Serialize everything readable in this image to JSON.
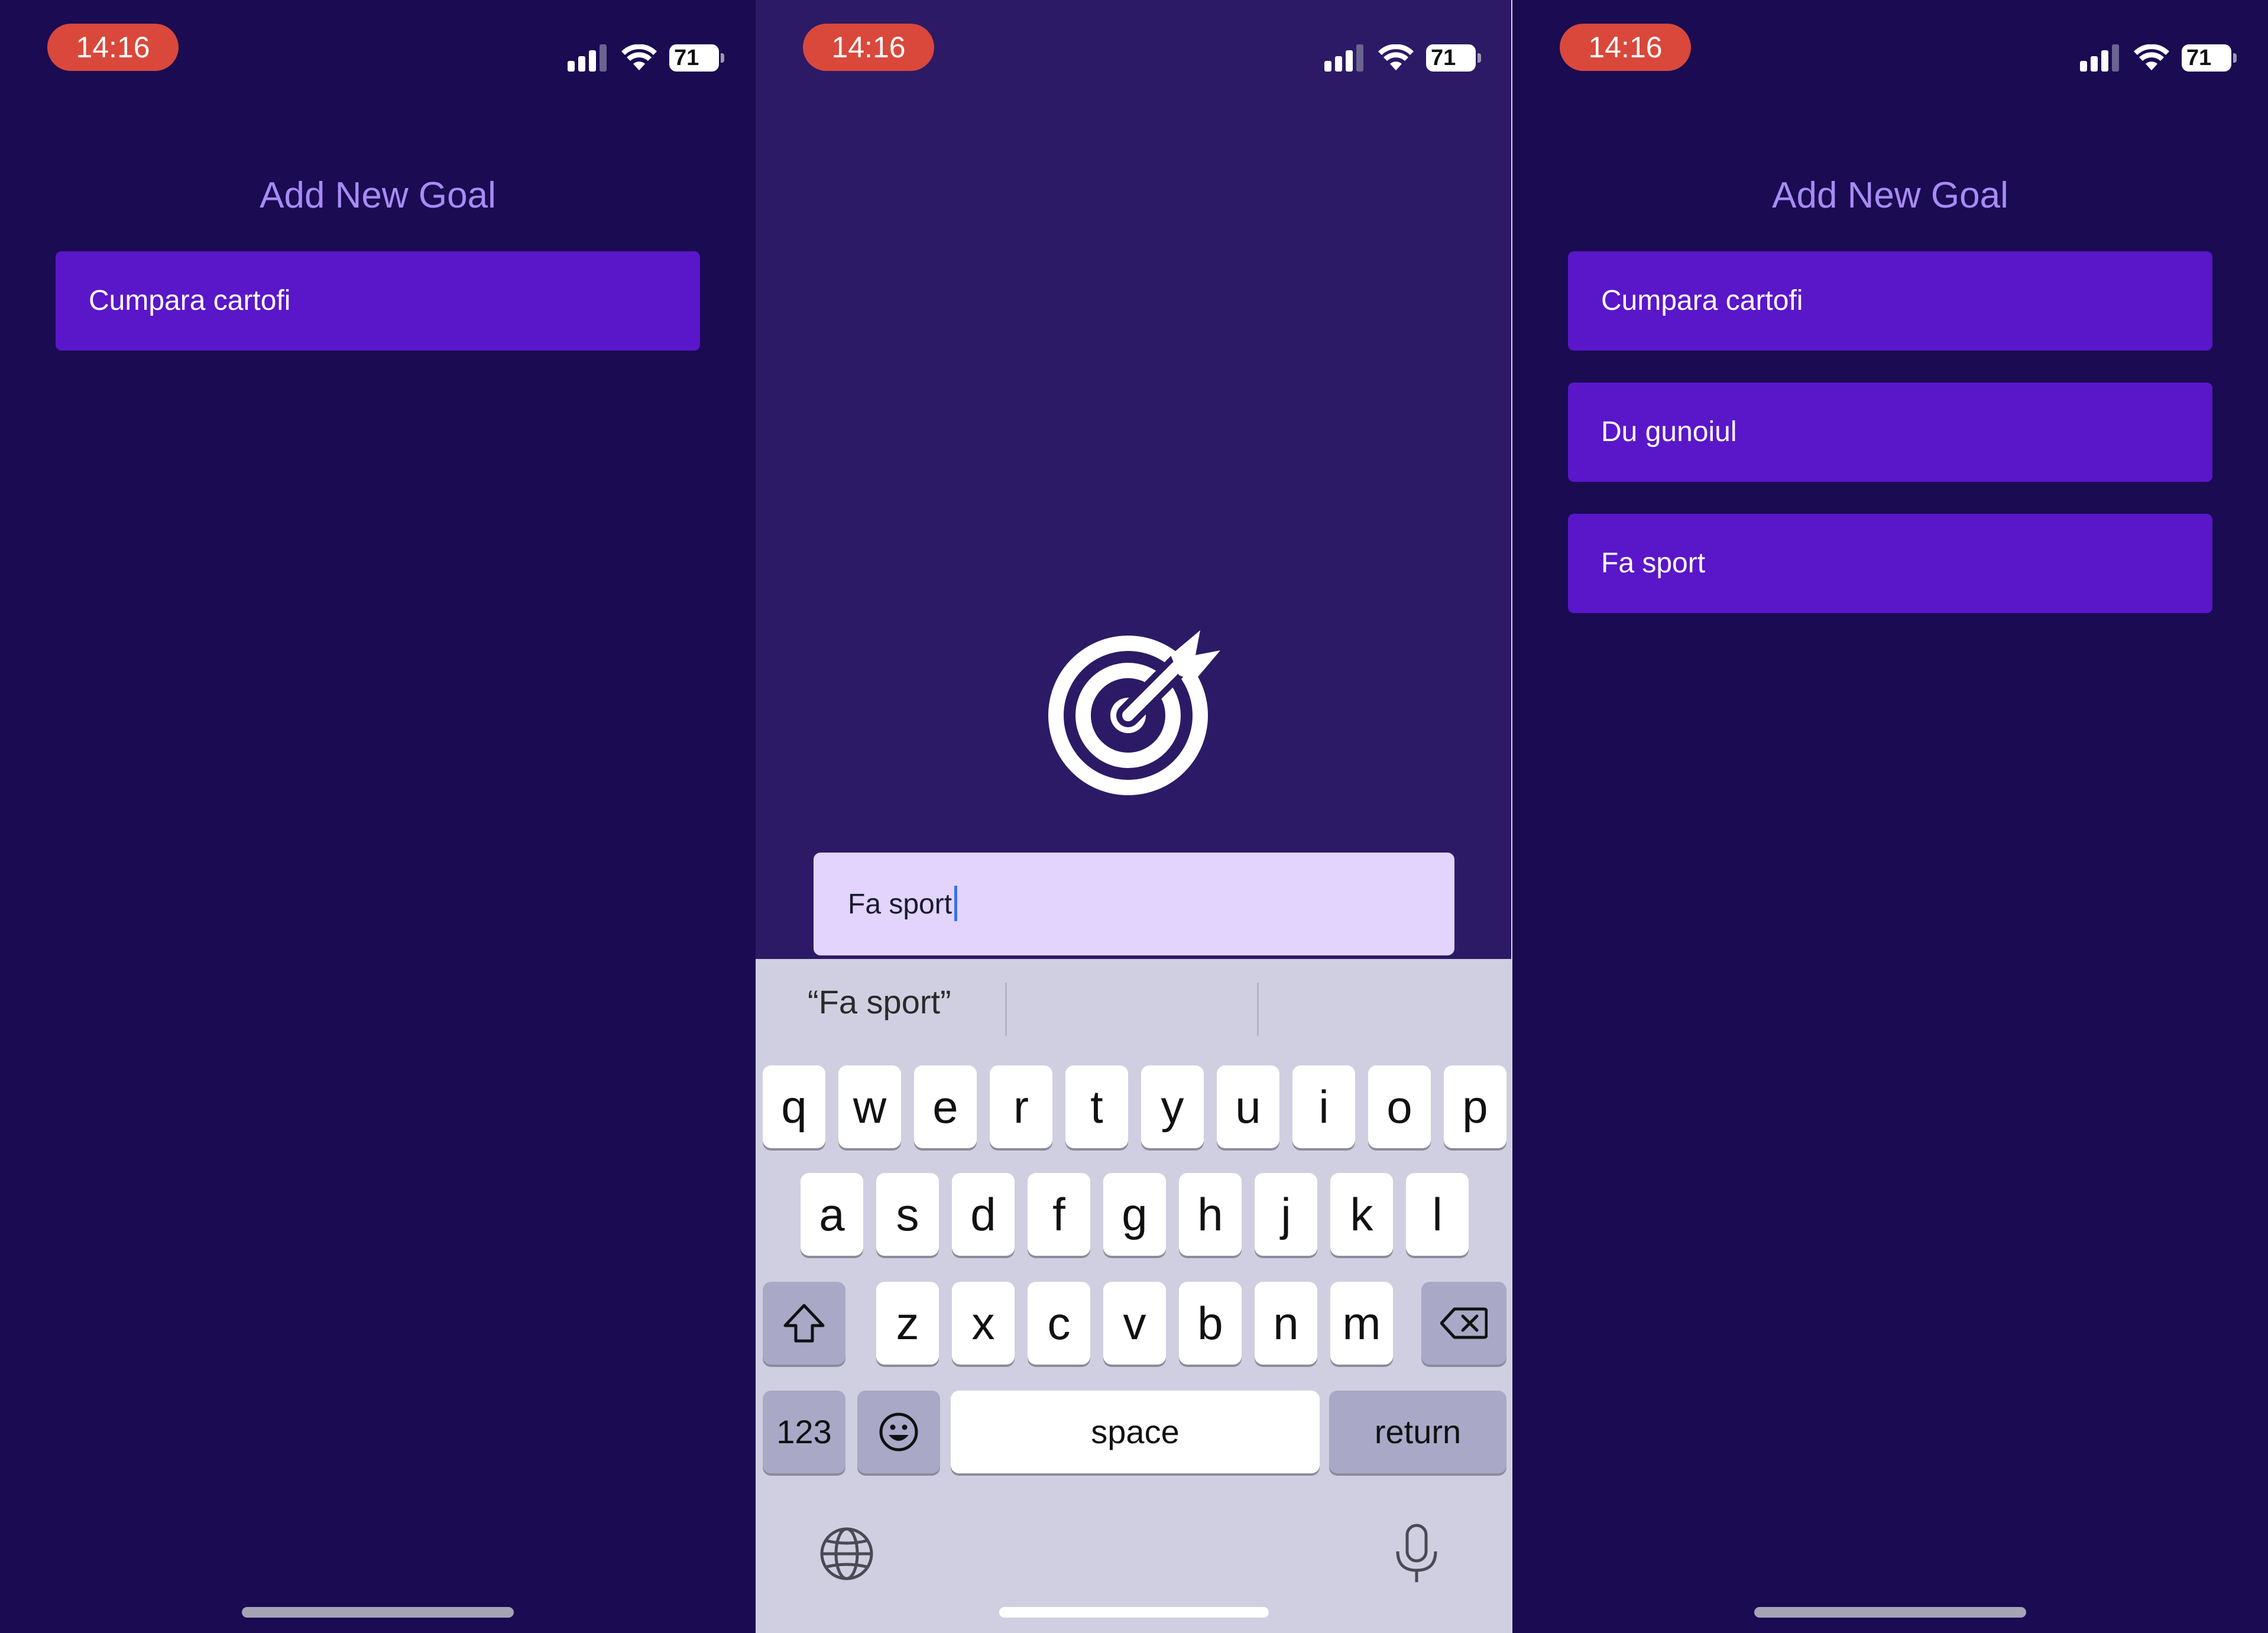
{
  "colors": {
    "background": "#1a0b52",
    "modal_background": "#2d1a66",
    "goal_item": "#5a16c9",
    "heading": "#a78bf5",
    "input_background": "#e2d4fc",
    "time_pill": "#d9483b"
  },
  "screens": [
    {
      "status": {
        "time": "14:16",
        "battery": "71"
      },
      "heading": "Add New Goal",
      "goals": [
        "Cumpara cartofi"
      ]
    },
    {
      "status": {
        "time": "14:16",
        "battery": "71"
      },
      "icon": "target-arrow-icon",
      "input": {
        "value": "Fa sport"
      },
      "keyboard": {
        "suggestion": "“Fa sport”",
        "row1": [
          "q",
          "w",
          "e",
          "r",
          "t",
          "y",
          "u",
          "i",
          "o",
          "p"
        ],
        "row2": [
          "a",
          "s",
          "d",
          "f",
          "g",
          "h",
          "j",
          "k",
          "l"
        ],
        "row3": [
          "z",
          "x",
          "c",
          "v",
          "b",
          "n",
          "m"
        ],
        "numbers_label": "123",
        "space_label": "space",
        "return_label": "return",
        "icons": [
          "shift-icon",
          "backspace-icon",
          "emoji-icon",
          "globe-icon",
          "microphone-icon"
        ]
      }
    },
    {
      "status": {
        "time": "14:16",
        "battery": "71"
      },
      "heading": "Add New Goal",
      "goals": [
        "Cumpara cartofi",
        "Du gunoiul",
        "Fa sport"
      ]
    }
  ]
}
